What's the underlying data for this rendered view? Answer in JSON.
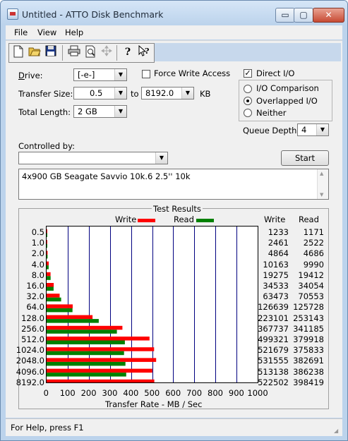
{
  "window": {
    "title": "Untitled - ATTO Disk Benchmark",
    "min_glyph": "▭",
    "max_glyph": "▢",
    "close_glyph": "✕"
  },
  "menu": {
    "items": [
      "File",
      "View",
      "Help"
    ]
  },
  "toolbar": {
    "icons": [
      "new-icon",
      "open-icon",
      "save-icon",
      "print-icon",
      "print-preview-icon",
      "move-icon",
      "help-icon",
      "context-help-icon"
    ]
  },
  "form": {
    "drive_label": "Drive:",
    "drive_value": "[-e-]",
    "force_write_label": "Force Write Access",
    "force_write_checked": false,
    "direct_io_label": "Direct I/O",
    "direct_io_checked": true,
    "transfer_size_label": "Transfer Size:",
    "transfer_from": "0.5",
    "to_label": "to",
    "transfer_to": "8192.0",
    "kb_label": "KB",
    "total_length_label": "Total Length:",
    "total_length_value": "2 GB",
    "io_options": [
      "I/O Comparison",
      "Overlapped I/O",
      "Neither"
    ],
    "io_selected": "Overlapped I/O",
    "queue_depth_label": "Queue Depth:",
    "queue_depth_value": "4",
    "controlled_by_label": "Controlled by:",
    "controlled_by_value": "",
    "start_label": "Start",
    "description": "4x900 GB Seagate Savvio 10k.6 2.5'' 10k"
  },
  "results": {
    "title": "Test Results",
    "write_legend": "Write",
    "read_legend": "Read",
    "write_col": "Write",
    "read_col": "Read",
    "write_color": "#ff0000",
    "read_color": "#008000"
  },
  "chart_data": {
    "type": "bar",
    "orientation": "horizontal",
    "title": "Test Results",
    "categories": [
      "0.5",
      "1.0",
      "2.0",
      "4.0",
      "8.0",
      "16.0",
      "32.0",
      "64.0",
      "128.0",
      "256.0",
      "512.0",
      "1024.0",
      "2048.0",
      "4096.0",
      "8192.0"
    ],
    "series": [
      {
        "name": "Write",
        "values": [
          1233,
          2461,
          4864,
          10163,
          19275,
          34533,
          63473,
          126639,
          223101,
          367737,
          499321,
          521679,
          531555,
          513138,
          522502
        ]
      },
      {
        "name": "Read",
        "values": [
          1171,
          2522,
          4686,
          9990,
          19412,
          34054,
          70553,
          125728,
          253143,
          341185,
          379918,
          375833,
          382691,
          386238,
          398419
        ]
      }
    ],
    "xlabel": "Transfer Rate - MB / Sec",
    "xticks": [
      "0",
      "100",
      "200",
      "300",
      "400",
      "500",
      "600",
      "700",
      "800",
      "900",
      "1000"
    ],
    "xlim": [
      0,
      1000
    ],
    "value_units": "KB/s",
    "grid": true,
    "legend": "top"
  },
  "status": {
    "text": "For Help, press F1"
  }
}
